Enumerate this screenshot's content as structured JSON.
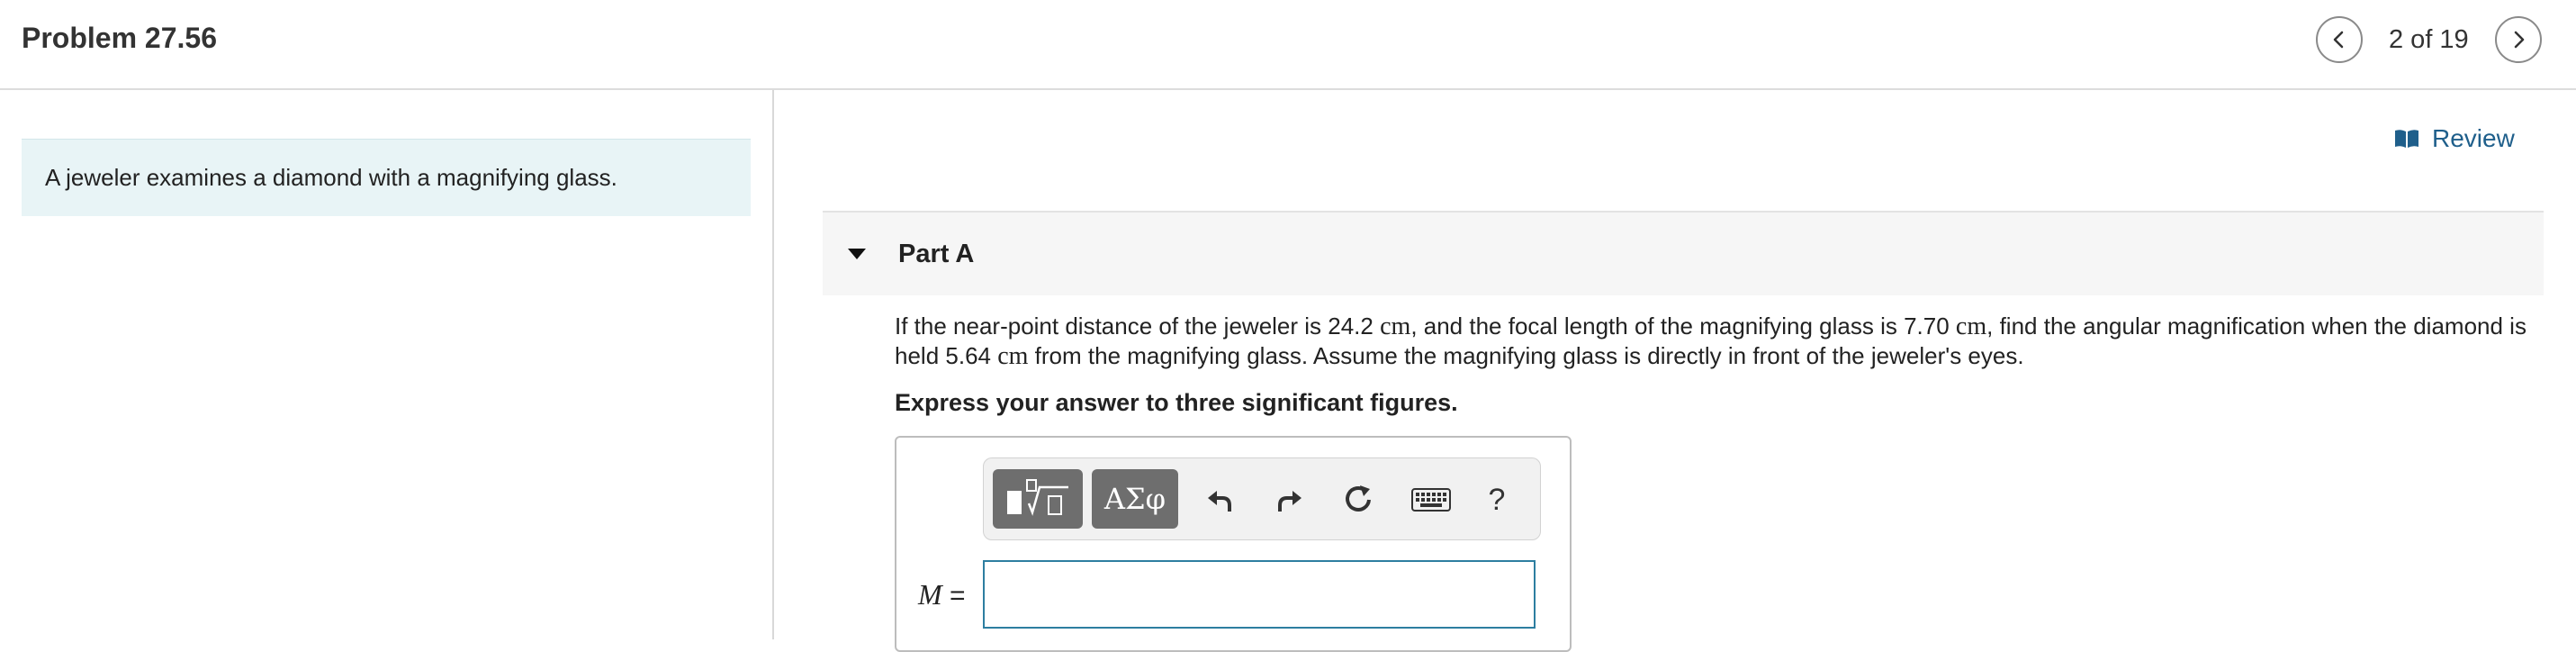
{
  "header": {
    "problem_title": "Problem 27.56",
    "page_count": "2 of 19",
    "prev_icon": "chevron-left-icon",
    "next_icon": "chevron-right-icon"
  },
  "intro": {
    "text": "A jeweler examines a diamond with a magnifying glass."
  },
  "review": {
    "label": "Review",
    "icon": "book-icon"
  },
  "part": {
    "title": "Part A",
    "caret_icon": "caret-down-icon",
    "question_segments": [
      "If the near-point distance of the jeweler is 24.2 ",
      "cm",
      ", and the focal length of the magnifying glass is 7.70 ",
      "cm",
      ", find the angular magnification when the diamond is held 5.64 ",
      "cm",
      " from the magnifying glass. Assume the magnifying glass is directly in front of the jeweler's eyes."
    ],
    "instruction": "Express your answer to three significant figures."
  },
  "answer": {
    "variable": "M",
    "equals": "=",
    "value": "",
    "toolbar": {
      "symbols_label": "ΑΣφ",
      "help_label": "?",
      "templates_icon": "templates-icon",
      "undo_icon": "undo-icon",
      "redo_icon": "redo-icon",
      "reset_icon": "reset-icon",
      "keyboard_icon": "keyboard-icon"
    }
  },
  "colors": {
    "intro_background": "#e8f4f6",
    "link": "#1f5f8b",
    "input_border": "#2d7ea0",
    "toolbar_button": "#6e6e6e"
  }
}
